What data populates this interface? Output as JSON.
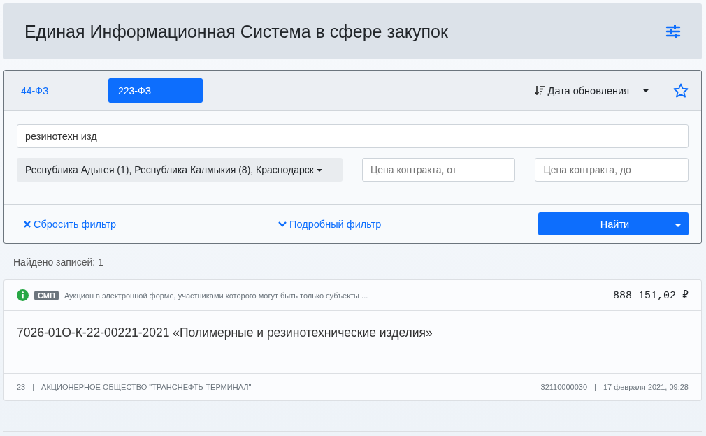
{
  "header": {
    "title": "Единая Информационная Система в сфере закупок"
  },
  "tabs": [
    {
      "label": "44-ФЗ",
      "selected": false
    },
    {
      "label": "223-ФЗ",
      "selected": true
    }
  ],
  "sort": {
    "label": "Дата обновления"
  },
  "filter": {
    "query": "резинотехн изд",
    "regions": "Республика Адыгея (1), Республика Калмыкия (8), Краснодарск",
    "price_from": {
      "placeholder": "Цена контракта, от"
    },
    "price_to": {
      "placeholder": "Цена контракта, до"
    },
    "reset": "Сбросить фильтр",
    "advanced": "Подробный фильтр",
    "search": "Найти"
  },
  "found": "Найдено записей: 1",
  "results": [
    {
      "badge": "СМП",
      "type": "Аукцион в электронной форме, участниками которого могут быть только субъекты ...",
      "price": "888 151,02 ₽",
      "title": "7026-01О-К-22-00221-2021 «Полимерные и резинотехнические изделия»",
      "separator": "|",
      "number": "23",
      "customer": "АКЦИОНЕРНОЕ ОБЩЕСТВО \"ТРАНСНЕФТЬ-ТЕРМИНАЛ\"",
      "registry": "32110000030",
      "date": "17 февраля 2021, 09:28"
    }
  ]
}
